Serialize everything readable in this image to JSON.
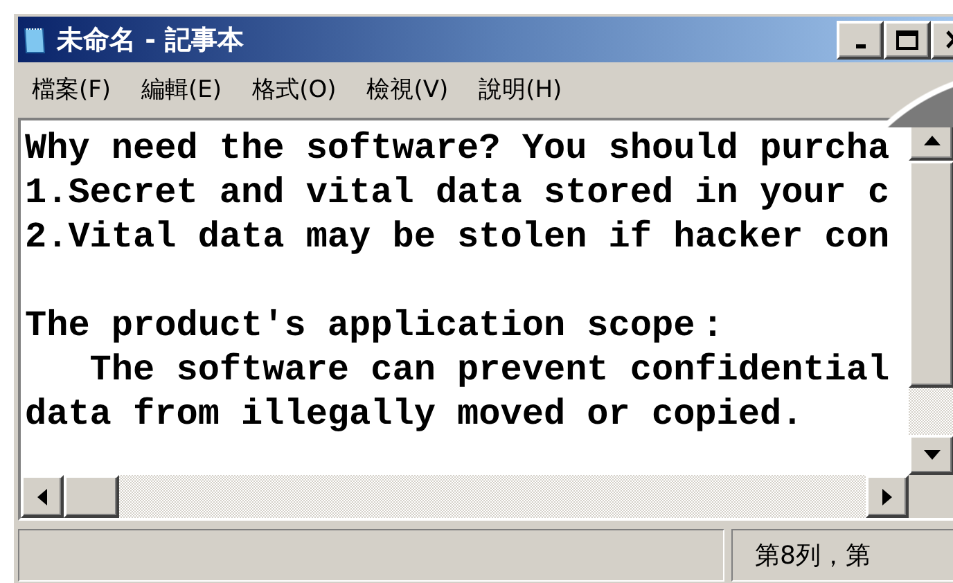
{
  "window": {
    "title": "未命名 - 記事本"
  },
  "menu": [
    {
      "label": "檔案(F)"
    },
    {
      "label": "編輯(E)"
    },
    {
      "label": "格式(O)"
    },
    {
      "label": "檢視(V)"
    },
    {
      "label": "說明(H)"
    }
  ],
  "document": {
    "paragraphs": [
      {
        "lines": [
          "Why need the software? You should purcha",
          "1.Secret and vital data stored in your c",
          "2.Vital data may be stolen if hacker con"
        ]
      },
      {
        "lines": [
          "The product's application scope：",
          "   The software can prevent confidential",
          "data from illegally moved or copied."
        ]
      }
    ]
  },
  "status_bar": {
    "position": "第8列，第"
  }
}
